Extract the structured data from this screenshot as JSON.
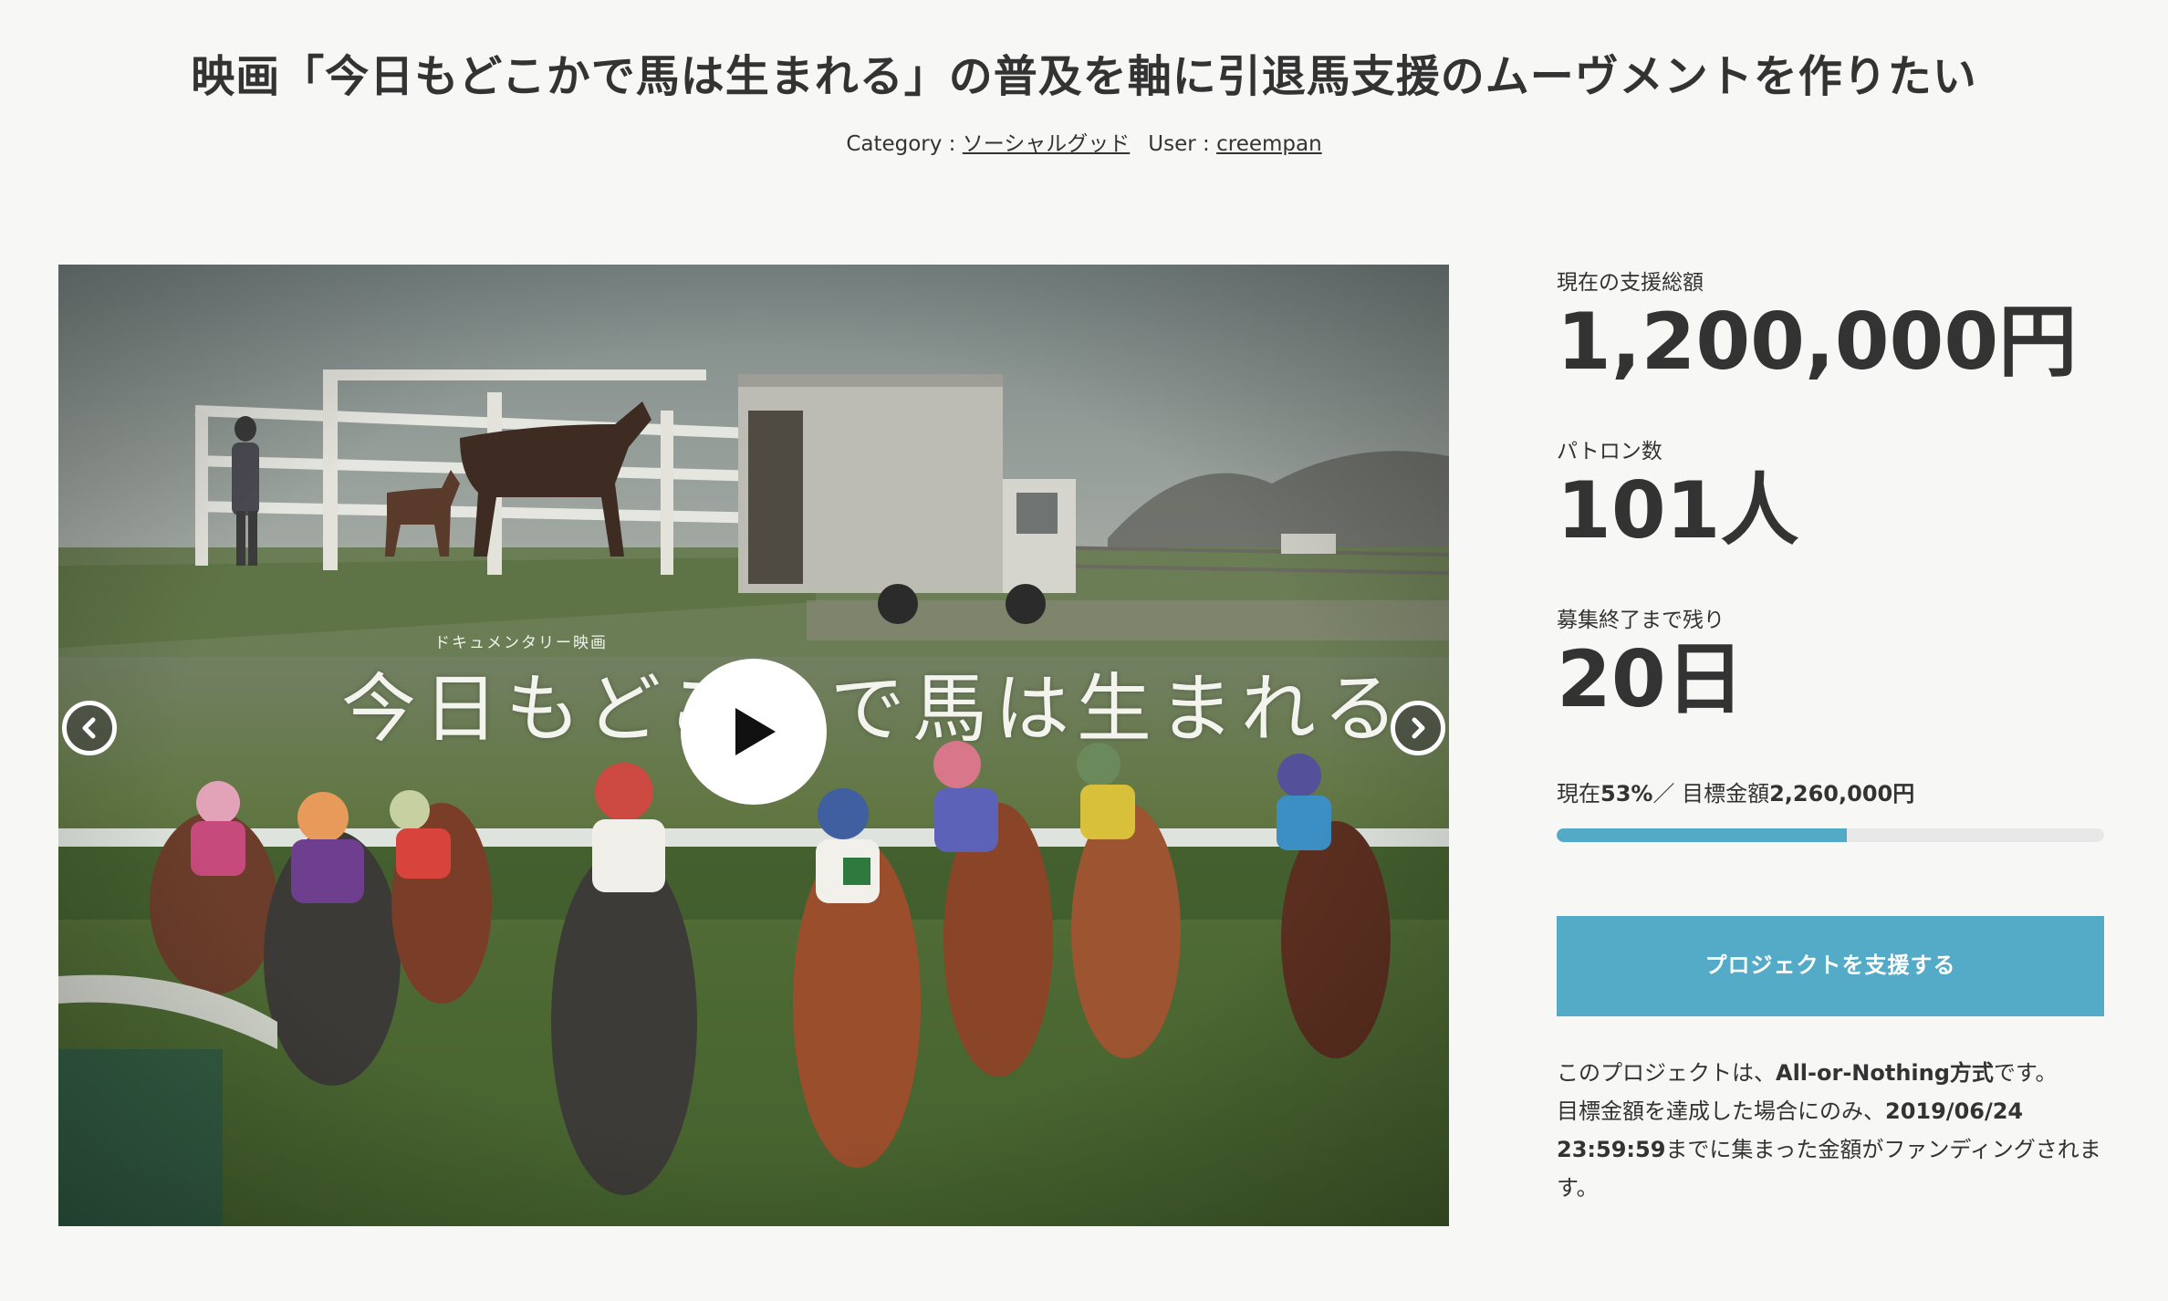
{
  "project": {
    "title": "映画「今日もどこかで馬は生まれる」の普及を軸に引退馬支援のムーヴメントを作りたい",
    "category_label": "Category : ",
    "category_value": "ソーシャルグッド",
    "user_label": "User : ",
    "user_value": "creempan"
  },
  "video": {
    "subtitle": "ドキュメンタリー映画",
    "film_title": "今日もどこかで馬は生まれる",
    "play_icon": "play-icon",
    "prev_icon": "chevron-left-icon",
    "next_icon": "chevron-right-icon"
  },
  "stats": {
    "amount_label": "現在の支援総額",
    "amount_value": "1,200,000円",
    "patrons_label": "パトロン数",
    "patrons_value": "101人",
    "days_label": "募集終了まで残り",
    "days_value": "20日"
  },
  "progress": {
    "prefix": "現在",
    "percent_text": "53%",
    "separator": "／ 目標金額",
    "goal": "2,260,000円",
    "fill_fraction": 0.53
  },
  "cta": {
    "support_label": "プロジェクトを支援する"
  },
  "notice": {
    "line1_a": "このプロジェクトは、",
    "line1_b": "All-or-Nothing方式",
    "line1_c": "です。",
    "line2_a": "目標金額を達成した場合にのみ、",
    "deadline": "2019/06/24 23:59:59",
    "line2_b": "までに集まった金額がファンディングされます。"
  },
  "colors": {
    "accent": "#53abc8",
    "progress_track": "#e8e8e8",
    "background": "#f7f7f6",
    "text": "#333333"
  }
}
